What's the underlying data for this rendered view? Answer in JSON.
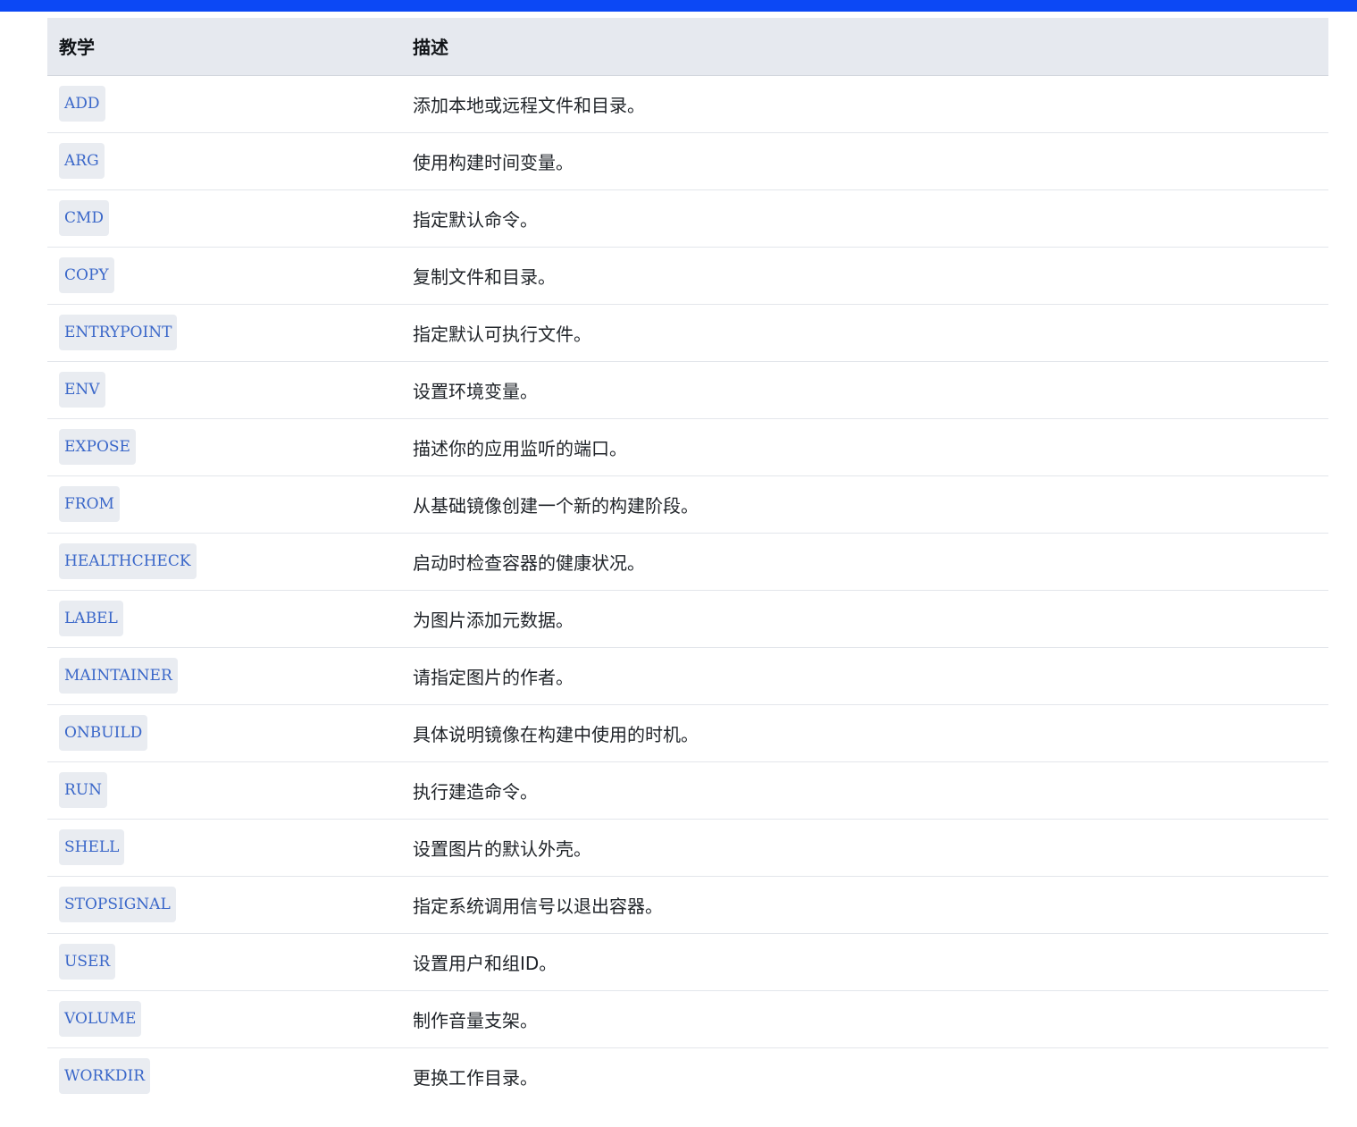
{
  "colors": {
    "top_bar": "#0c48f5",
    "header_bg": "#e6e9ef",
    "code_text": "#3a67c9",
    "code_bg": "#e9ecf1"
  },
  "table": {
    "headers": {
      "instruction": "教学",
      "description": "描述"
    },
    "rows": [
      {
        "instruction": "ADD",
        "description": "添加本地或远程文件和目录。"
      },
      {
        "instruction": "ARG",
        "description": "使用构建时间变量。"
      },
      {
        "instruction": "CMD",
        "description": "指定默认命令。"
      },
      {
        "instruction": "COPY",
        "description": "复制文件和目录。"
      },
      {
        "instruction": "ENTRYPOINT",
        "description": "指定默认可执行文件。"
      },
      {
        "instruction": "ENV",
        "description": "设置环境变量。"
      },
      {
        "instruction": "EXPOSE",
        "description": "描述你的应用监听的端口。"
      },
      {
        "instruction": "FROM",
        "description": "从基础镜像创建一个新的构建阶段。"
      },
      {
        "instruction": "HEALTHCHECK",
        "description": "启动时检查容器的健康状况。"
      },
      {
        "instruction": "LABEL",
        "description": "为图片添加元数据。"
      },
      {
        "instruction": "MAINTAINER",
        "description": "请指定图片的作者。"
      },
      {
        "instruction": "ONBUILD",
        "description": "具体说明镜像在构建中使用的时机。"
      },
      {
        "instruction": "RUN",
        "description": "执行建造命令。"
      },
      {
        "instruction": "SHELL",
        "description": "设置图片的默认外壳。"
      },
      {
        "instruction": "STOPSIGNAL",
        "description": "指定系统调用信号以退出容器。"
      },
      {
        "instruction": "USER",
        "description": "设置用户和组ID。"
      },
      {
        "instruction": "VOLUME",
        "description": "制作音量支架。"
      },
      {
        "instruction": "WORKDIR",
        "description": "更换工作目录。"
      }
    ]
  }
}
